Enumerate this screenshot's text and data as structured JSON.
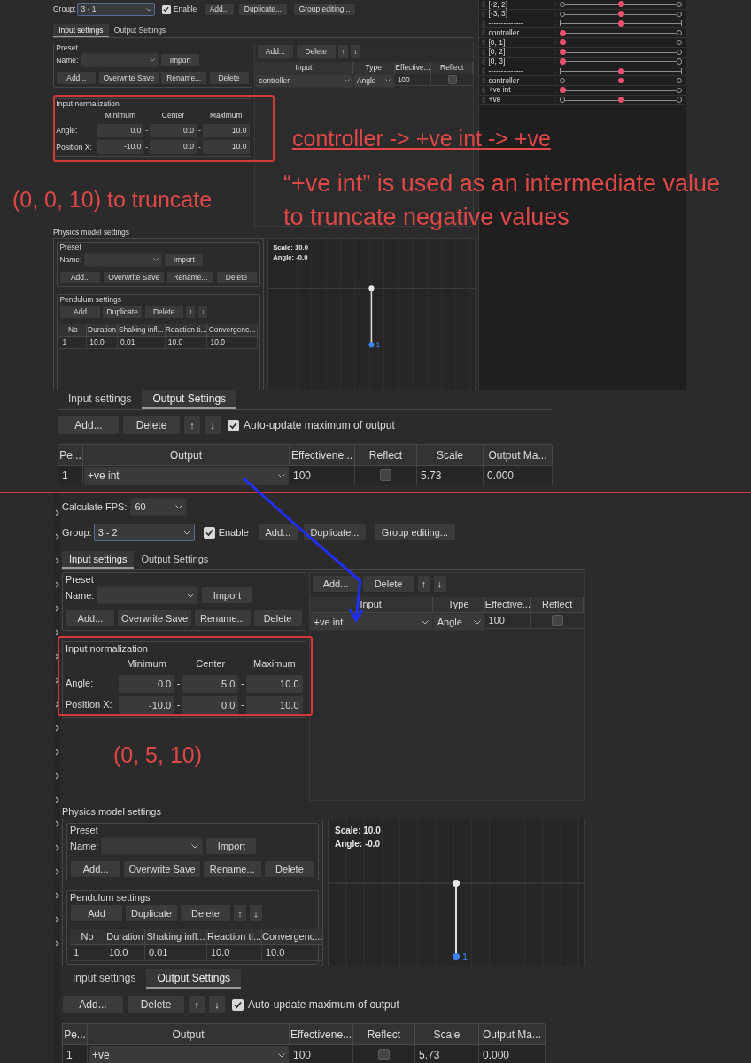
{
  "screen_1": {
    "group": {
      "label": "Group:",
      "value": "3 - 1"
    },
    "enable": {
      "label": "Enable",
      "checked": true
    },
    "group_buttons": [
      "Add...",
      "Duplicate...",
      "Group editing..."
    ],
    "tabs": [
      {
        "label": "Input settings",
        "selected": true
      },
      {
        "label": "Output Settings",
        "selected": false
      }
    ],
    "preset": {
      "title": "Preset",
      "name_label": "Name:",
      "import_button": "Import",
      "buttons": [
        "Add...",
        "Overwrite Save",
        "Rename...",
        "Delete"
      ]
    },
    "input_normalization": {
      "title": "Input normalization",
      "columns": [
        "Minimum",
        "Center",
        "Maximum"
      ],
      "separator": "-",
      "rows": [
        {
          "label": "Angle:",
          "values": [
            "0.0",
            "0.0",
            "10.0"
          ]
        },
        {
          "label": "Position X:",
          "values": [
            "-10.0",
            "0.0",
            "10.0"
          ]
        }
      ]
    },
    "input_table": {
      "buttons": [
        "Add...",
        "Delete",
        "↑",
        "↓"
      ],
      "columns": [
        "Input",
        "Type",
        "Effective...",
        "Reflect"
      ],
      "rows": [
        {
          "input": "controller",
          "type": "Angle",
          "effectiveness": "100",
          "reflect": false
        }
      ]
    },
    "physics": {
      "title": "Physics model settings",
      "preset": {
        "title": "Preset",
        "name_label": "Name:",
        "import_button": "Import",
        "buttons": [
          "Add...",
          "Overwrite Save",
          "Rename...",
          "Delete"
        ]
      },
      "pendulum": {
        "title": "Pendulum settings",
        "buttons": [
          "Add",
          "Duplicate",
          "Delete",
          "↑",
          "↓"
        ],
        "columns": [
          "No",
          "Duration",
          "Shaking infl...",
          "Reaction ti...",
          "Convergenc..."
        ],
        "rows": [
          [
            "1",
            "10.0",
            "0.01",
            "10.0",
            "10.0"
          ]
        ]
      },
      "view": {
        "scale": "Scale: 10.0",
        "angle": "Angle: -0.0",
        "point_label": "1"
      }
    }
  },
  "sliders": [
    {
      "label": "[-2, 2]",
      "kind": "bipolar",
      "level": 0.5
    },
    {
      "label": "[-3, 3]",
      "kind": "bipolar",
      "level": 0.5
    },
    {
      "label": "--------------",
      "kind": "separator",
      "level": 0.5
    },
    {
      "label": "controller",
      "kind": "unipolar",
      "level": 0
    },
    {
      "label": "[0, 1]",
      "kind": "unipolar",
      "level": 0
    },
    {
      "label": "[0, 2]",
      "kind": "unipolar",
      "level": 0
    },
    {
      "label": "[0, 3]",
      "kind": "unipolar",
      "level": 0
    },
    {
      "label": "--------------",
      "kind": "separator",
      "level": 0.5
    },
    {
      "label": "controller",
      "kind": "bipolar",
      "level": 0.5
    },
    {
      "label": "+ve int",
      "kind": "unipolar",
      "level": 0
    },
    {
      "label": "+ve",
      "kind": "bipolar",
      "level": 0.5
    }
  ],
  "output_1": {
    "tabs": [
      {
        "label": "Input settings",
        "selected": false
      },
      {
        "label": "Output Settings",
        "selected": true
      }
    ],
    "buttons": [
      "Add...",
      "Delete",
      "↑",
      "↓"
    ],
    "auto_update": {
      "label": "Auto-update maximum of output",
      "checked": true
    },
    "columns": [
      "Pe...",
      "Output",
      "Effectivene...",
      "Reflect",
      "Scale",
      "Output Ma..."
    ],
    "rows": [
      {
        "no": "1",
        "output": "+ve int",
        "effectiveness": "100",
        "reflect": false,
        "scale": "5.73",
        "output_max": "0.000"
      }
    ]
  },
  "screen_2": {
    "fps": {
      "label": "Calculate FPS:",
      "value": "60"
    },
    "group": {
      "label": "Group:",
      "value": "3 - 2"
    },
    "enable": {
      "label": "Enable",
      "checked": true
    },
    "group_buttons": [
      "Add...",
      "Duplicate...",
      "Group editing..."
    ],
    "tabs": [
      {
        "label": "Input settings",
        "selected": true
      },
      {
        "label": "Output Settings",
        "selected": false
      }
    ],
    "preset": {
      "title": "Preset",
      "name_label": "Name:",
      "import_button": "Import",
      "buttons": [
        "Add...",
        "Overwrite Save",
        "Rename...",
        "Delete"
      ]
    },
    "input_normalization": {
      "title": "Input normalization",
      "columns": [
        "Minimum",
        "Center",
        "Maximum"
      ],
      "separator": "-",
      "rows": [
        {
          "label": "Angle:",
          "values": [
            "0.0",
            "5.0",
            "10.0"
          ]
        },
        {
          "label": "Position X:",
          "values": [
            "-10.0",
            "0.0",
            "10.0"
          ]
        }
      ]
    },
    "input_table": {
      "buttons": [
        "Add...",
        "Delete",
        "↑",
        "↓"
      ],
      "columns": [
        "Input",
        "Type",
        "Effective...",
        "Reflect"
      ],
      "rows": [
        {
          "input": "+ve int",
          "type": "Angle",
          "effectiveness": "100",
          "reflect": false
        }
      ]
    },
    "physics": {
      "title": "Physics model settings",
      "preset": {
        "title": "Preset",
        "name_label": "Name:",
        "import_button": "Import",
        "buttons": [
          "Add...",
          "Overwrite Save",
          "Rename...",
          "Delete"
        ]
      },
      "pendulum": {
        "title": "Pendulum settings",
        "buttons": [
          "Add",
          "Duplicate",
          "Delete",
          "↑",
          "↓"
        ],
        "columns": [
          "No",
          "Duration",
          "Shaking infl...",
          "Reaction ti...",
          "Convergenc..."
        ],
        "rows": [
          [
            "1",
            "10.0",
            "0.01",
            "10.0",
            "10.0"
          ]
        ]
      },
      "view": {
        "scale": "Scale: 10.0",
        "angle": "Angle: -0.0",
        "point_label": "1"
      }
    }
  },
  "output_2": {
    "tabs": [
      {
        "label": "Input settings",
        "selected": false
      },
      {
        "label": "Output Settings",
        "selected": true
      }
    ],
    "buttons": [
      "Add...",
      "Delete",
      "↑",
      "↓"
    ],
    "auto_update": {
      "label": "Auto-update maximum of output",
      "checked": true
    },
    "columns": [
      "Pe...",
      "Output",
      "Effectivene...",
      "Reflect",
      "Scale",
      "Output Ma..."
    ],
    "rows": [
      {
        "no": "1",
        "output": "+ve",
        "effectiveness": "100",
        "reflect": false,
        "scale": "5.73",
        "output_max": "0.000"
      }
    ]
  },
  "annotations": {
    "chain": "controller -> +ve int -> +ve",
    "note": "“+ve int” is used as an intermediate value to truncate negative values",
    "range_1": "(0, 0, 10) to truncate",
    "range_2": "(0, 5, 10)"
  }
}
